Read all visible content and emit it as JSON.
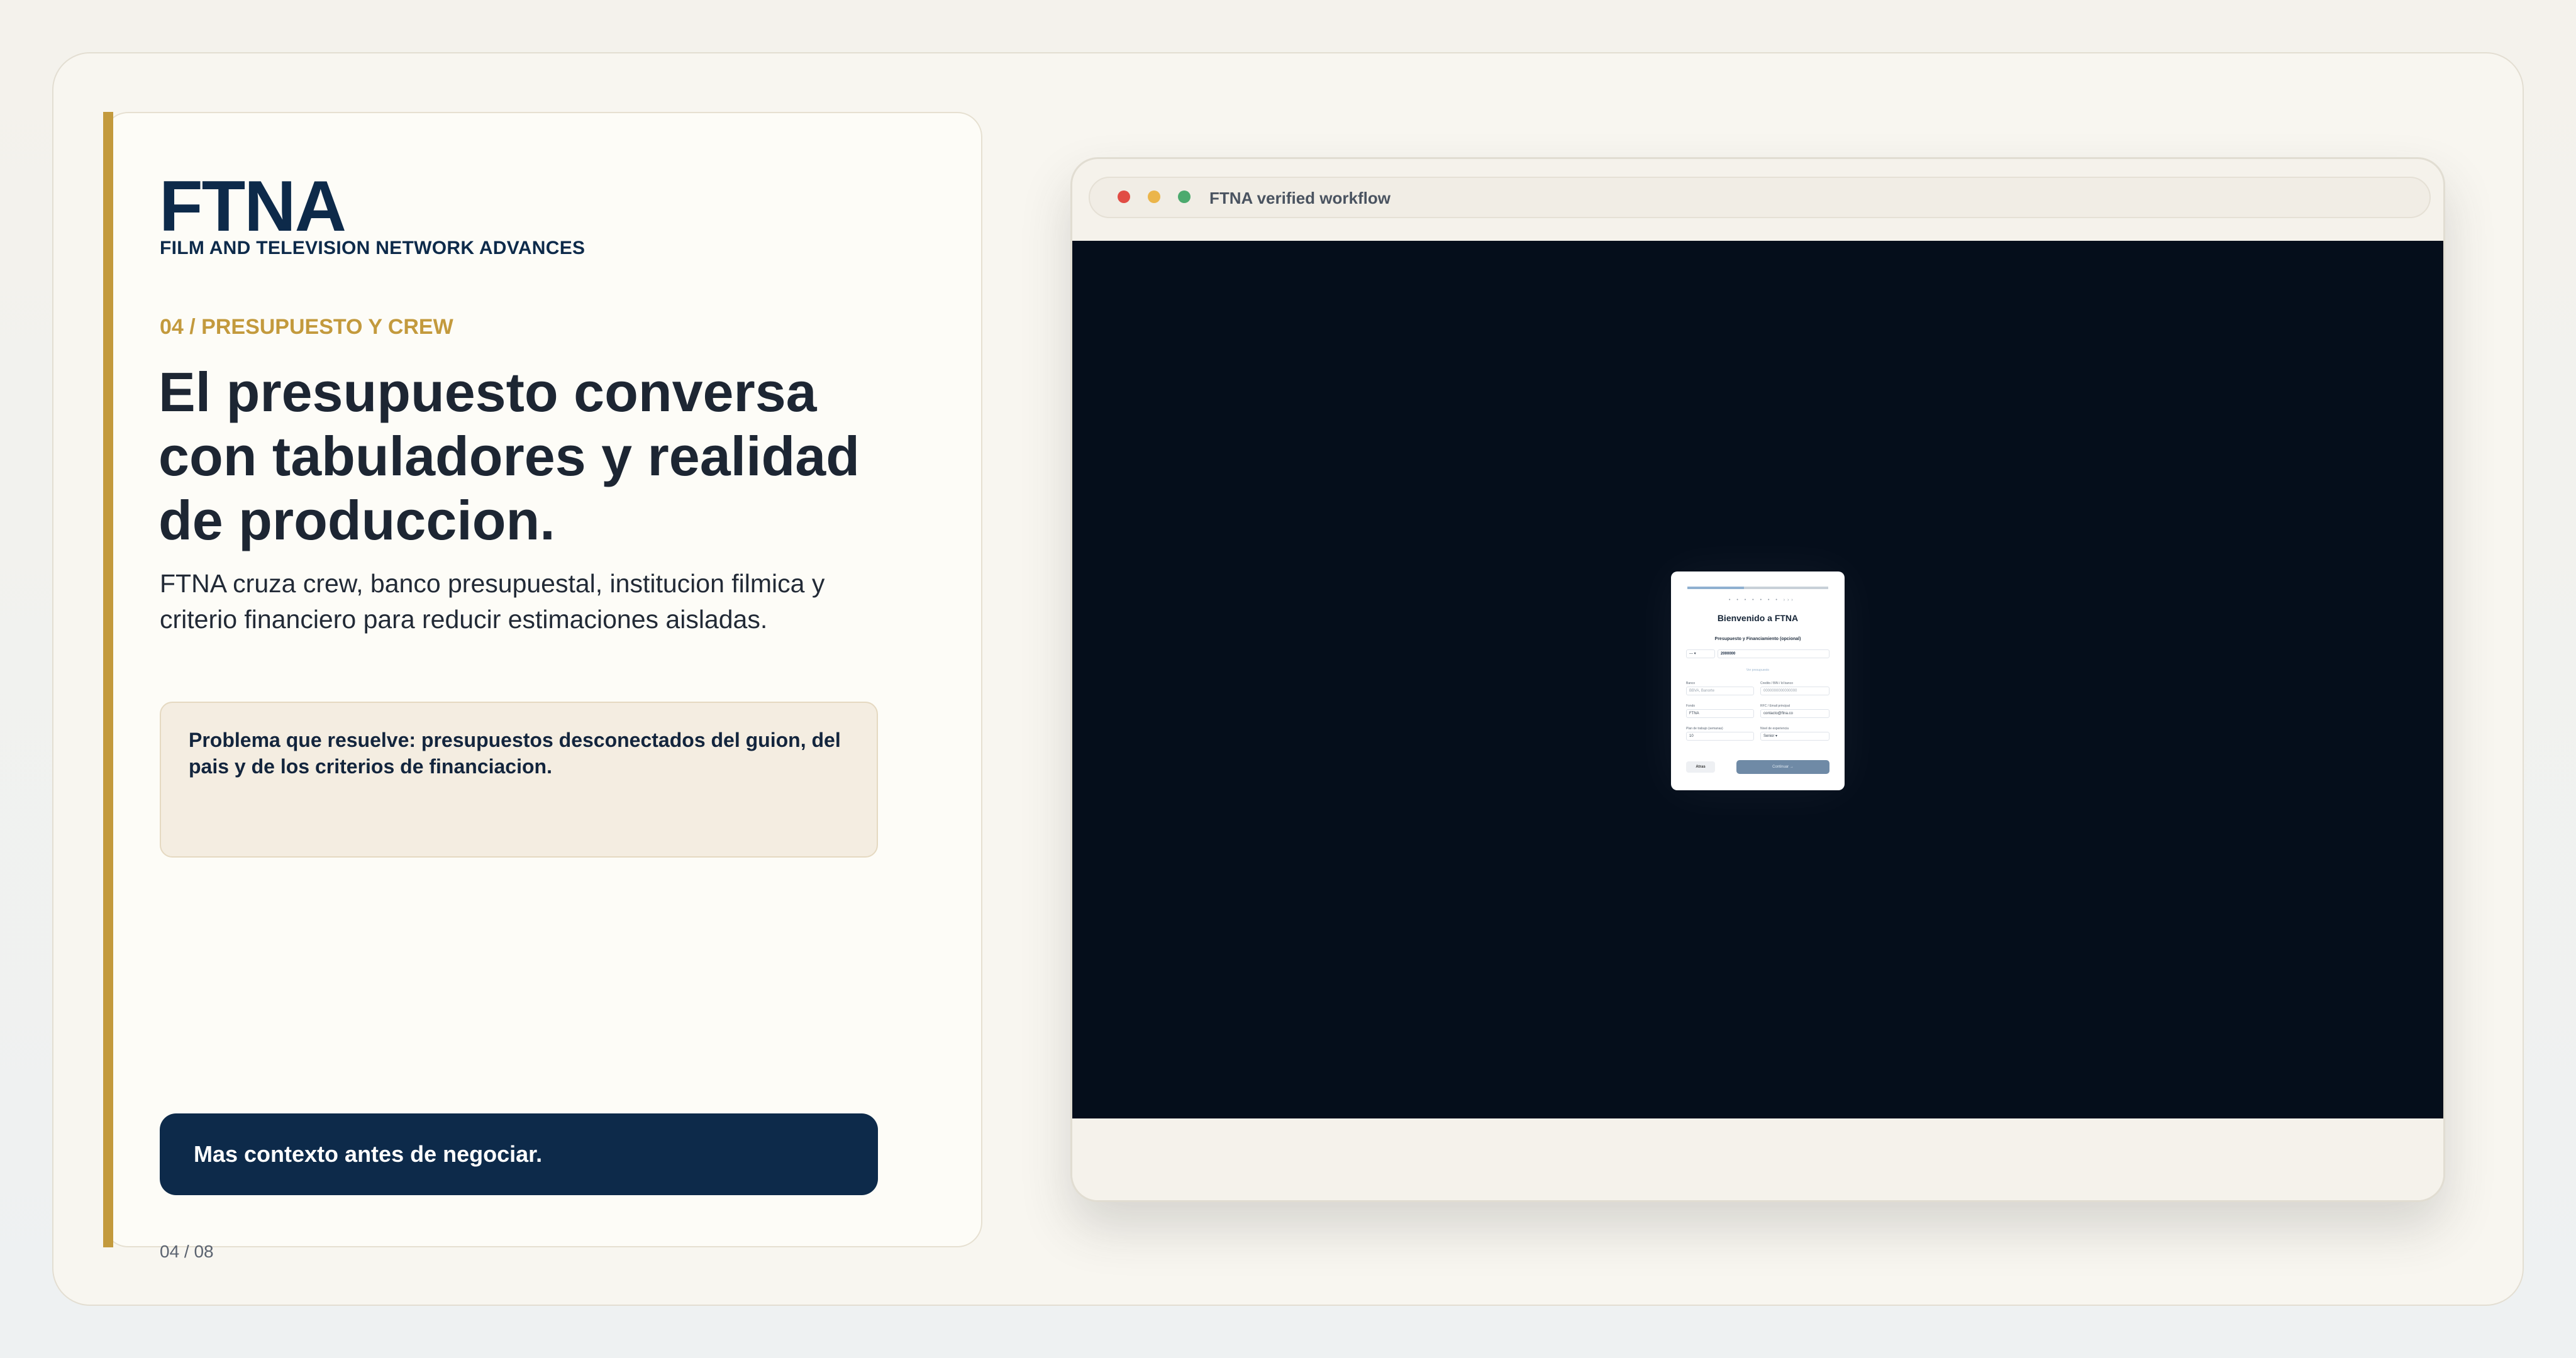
{
  "brand": {
    "logo": "FTNA",
    "tagline": "FILM AND TELEVISION NETWORK ADVANCES",
    "accent_color": "#c39a3d",
    "primary_color": "#0d2a4a"
  },
  "slide": {
    "eyebrow": "04 / PRESUPUESTO Y CREW",
    "headline": "El presupuesto conversa con tabuladores y realidad de produccion.",
    "lead": "FTNA cruza crew, banco presupuestal, institucion filmica y criterio financiero para reducir estimaciones aisladas.",
    "problem": "Problema que resuelve: presupuestos desconectados del guion, del pais y de los criterios de financiacion.",
    "cta": "Mas contexto antes de negociar.",
    "pager": "04 / 08"
  },
  "browser": {
    "title": "FTNA verified workflow",
    "window_controls": [
      "close-dot",
      "minimize-dot",
      "maximize-dot"
    ]
  },
  "modal": {
    "steps": "• • • • • • • ›››",
    "title": "Bienvenido a FTNA",
    "subtitle": "Presupuesto y Financiamiento (opcional)",
    "currency_select": "— ▾",
    "budget_value": "2000000",
    "hint": "Ver presupuesto",
    "fields": [
      {
        "label": "Banco",
        "value": "BBVA, Banorte"
      },
      {
        "label": "Credito / BIN / Id banco",
        "value": "0000000000000000"
      },
      {
        "label": "Fondo",
        "value": "FTNA"
      },
      {
        "label": "RFC / Email principal",
        "value": "contacto@ftna.co"
      },
      {
        "label": "Plan de trabajo (semanas)",
        "value": "10"
      },
      {
        "label": "Nivel de experiencia",
        "value": "Senior ▾"
      }
    ],
    "back_label": "Atras",
    "continue_label": "Continuar →"
  }
}
